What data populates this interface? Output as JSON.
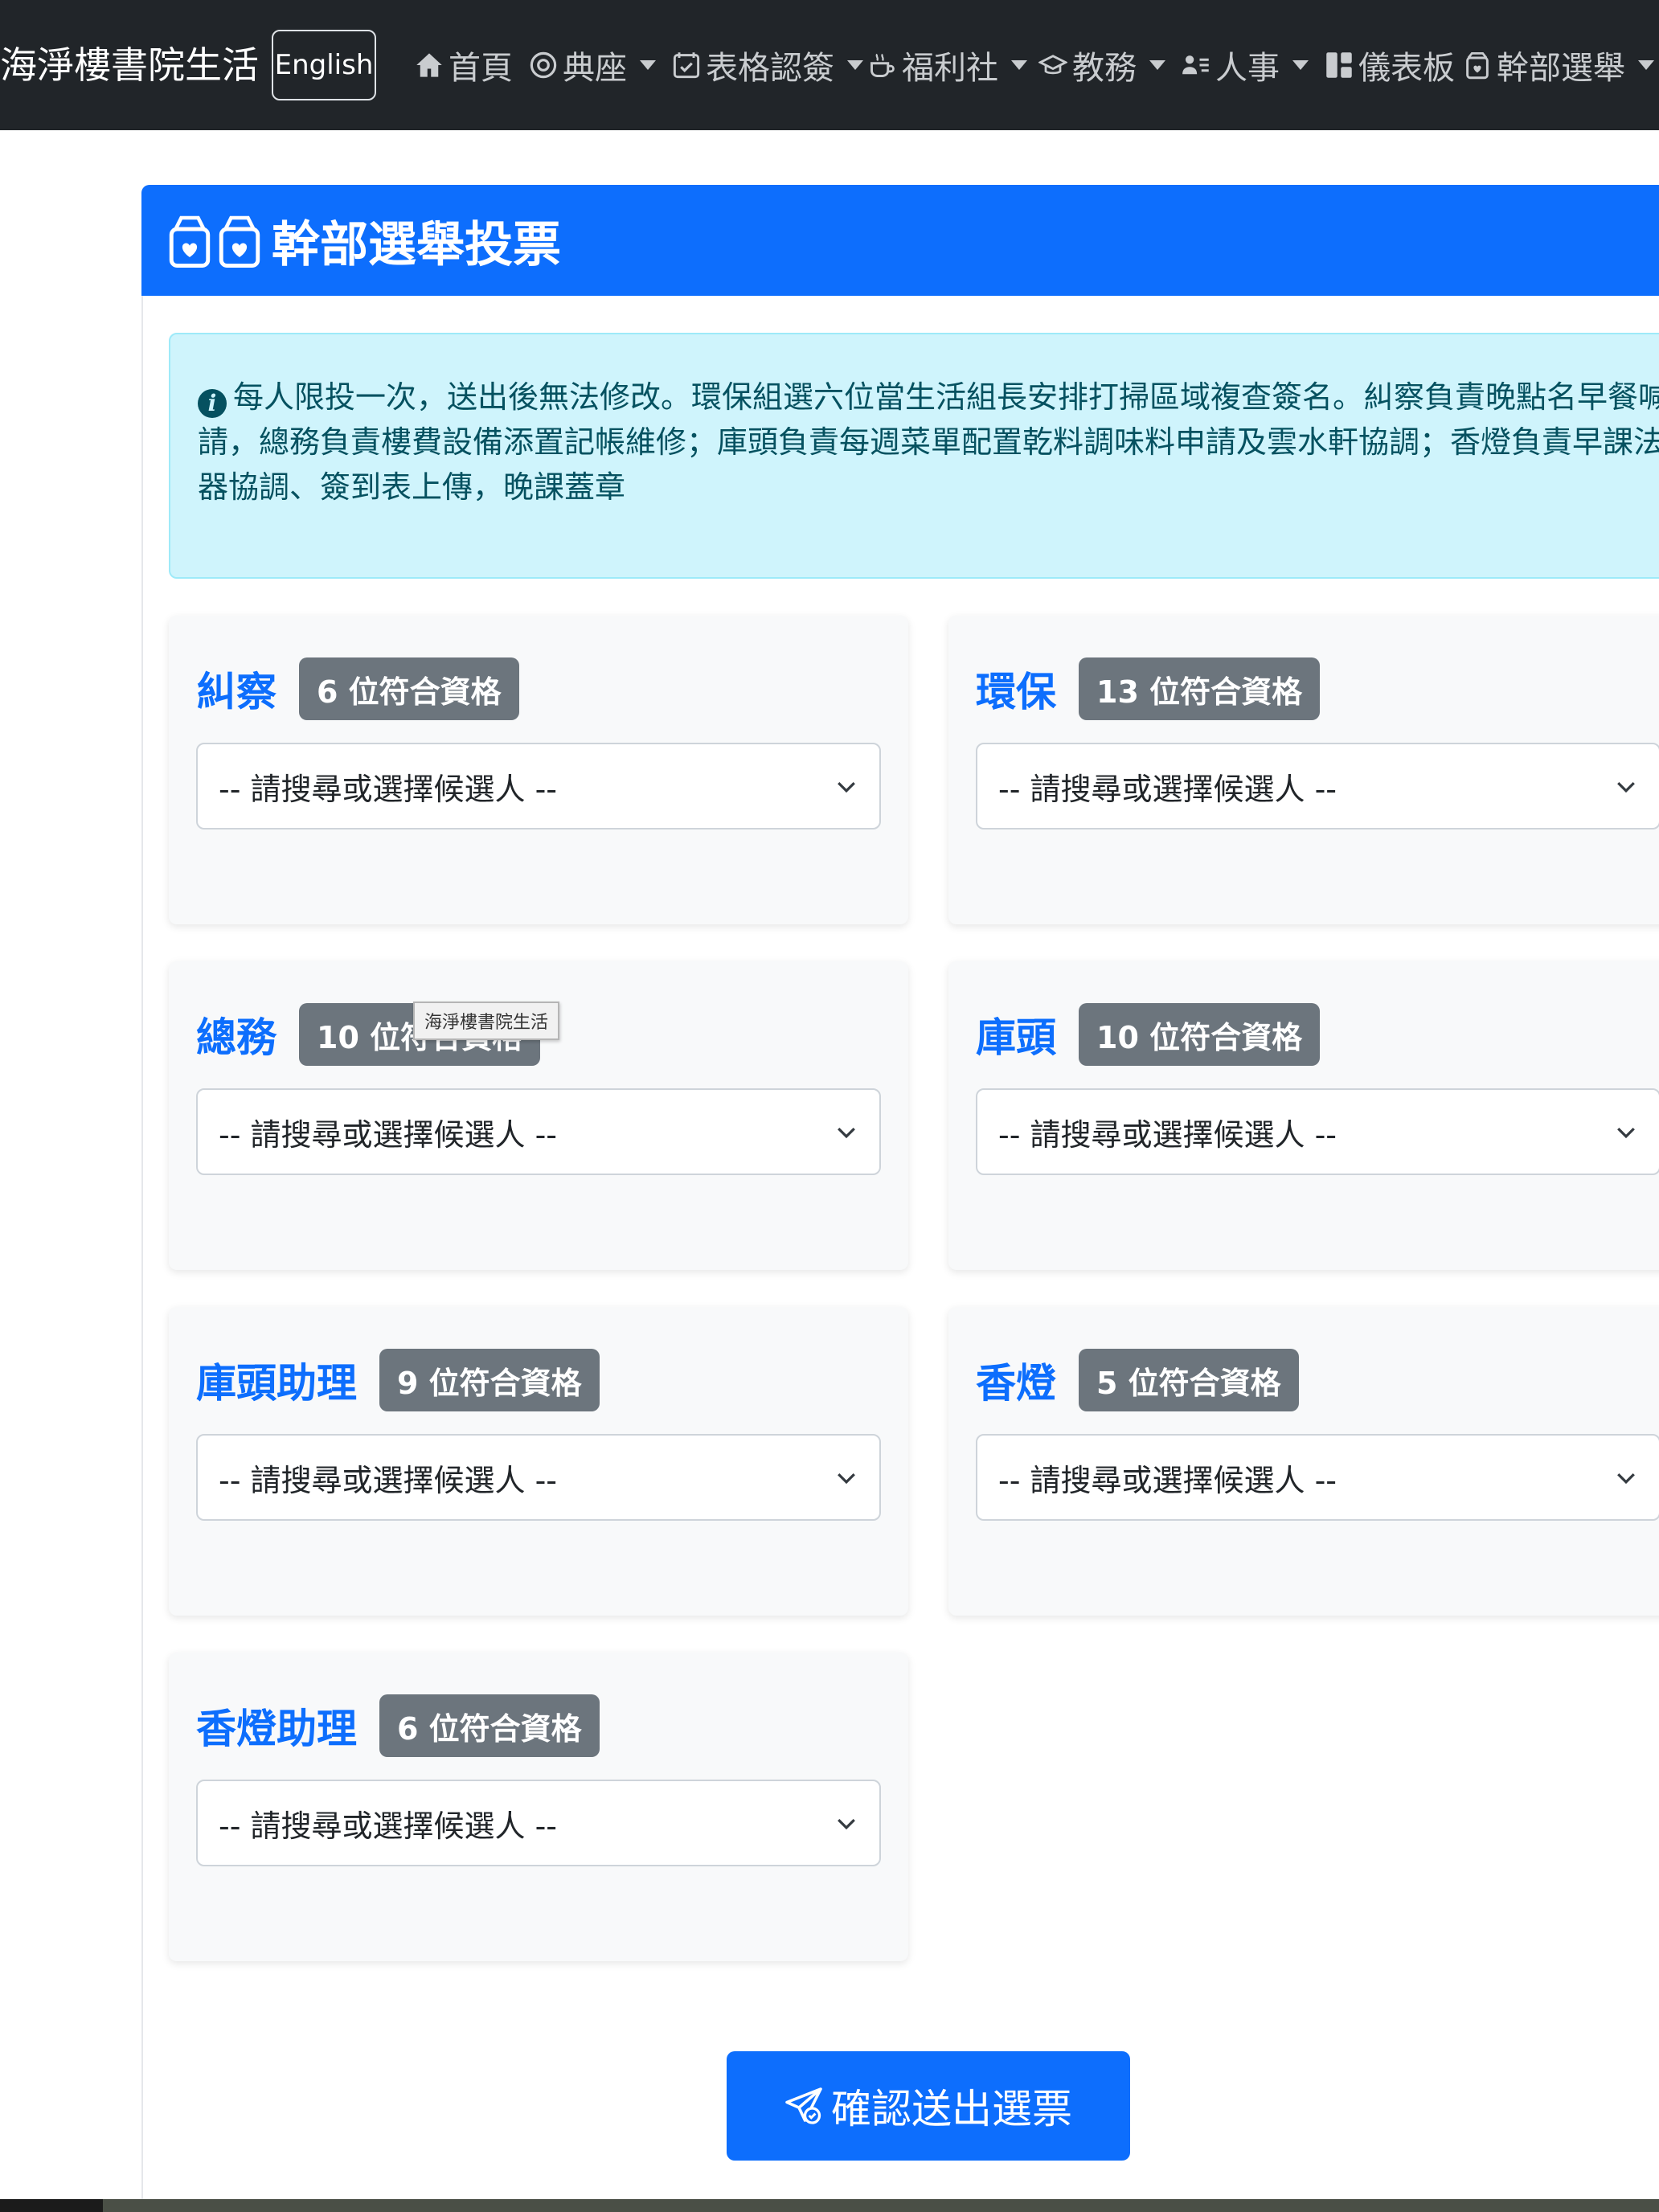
{
  "navbar": {
    "brand": "海淨樓書院生活",
    "lang_button": "English",
    "items": [
      {
        "label": "首頁",
        "icon": "house-icon",
        "dropdown": false
      },
      {
        "label": "典座",
        "icon": "bowl-icon",
        "dropdown": true
      },
      {
        "label": "表格認簽",
        "icon": "calendar-check-icon",
        "dropdown": true
      },
      {
        "label": "福利社",
        "icon": "cup-hot-icon",
        "dropdown": true
      },
      {
        "label": "教務",
        "icon": "mortarboard-icon",
        "dropdown": true
      },
      {
        "label": "人事",
        "icon": "person-lines-icon",
        "dropdown": true
      },
      {
        "label": "儀表板",
        "icon": "dashboard-icon",
        "dropdown": false
      },
      {
        "label": "幹部選舉",
        "icon": "ballot-box-icon",
        "dropdown": true
      }
    ]
  },
  "card": {
    "title": "幹部選舉投票",
    "icon": "ballot-box-icon"
  },
  "alert": {
    "icon": "info-circle-icon",
    "text": "每人限投一次，送出後無法修改。環保組選六位當生活組長安排打掃區域複查簽名。糾察負責晚點名早餐喊請，總務負責樓費設備添置記帳維修；庫頭負責每週菜單配置乾料調味料申請及雲水軒協調；香燈負責早課法器協調、簽到表上傳，晚課蓋章"
  },
  "positions": [
    {
      "name": "糾察",
      "badge": "6 位符合資格",
      "placeholder": "-- 請搜尋或選擇候選人 --"
    },
    {
      "name": "環保",
      "badge": "13 位符合資格",
      "placeholder": "-- 請搜尋或選擇候選人 --"
    },
    {
      "name": "總務",
      "badge": "10 位符合資格",
      "placeholder": "-- 請搜尋或選擇候選人 --"
    },
    {
      "name": "庫頭",
      "badge": "10 位符合資格",
      "placeholder": "-- 請搜尋或選擇候選人 --"
    },
    {
      "name": "庫頭助理",
      "badge": "9 位符合資格",
      "placeholder": "-- 請搜尋或選擇候選人 --"
    },
    {
      "name": "香燈",
      "badge": "5 位符合資格",
      "placeholder": "-- 請搜尋或選擇候選人 --"
    },
    {
      "name": "香燈助理",
      "badge": "6 位符合資格",
      "placeholder": "-- 請搜尋或選擇候選人 --"
    }
  ],
  "tooltip": "海淨樓書院生活",
  "submit": {
    "label": "確認送出選票",
    "icon": "send-check-icon"
  },
  "colors": {
    "navbar": "#212529",
    "primary": "#0d6efd",
    "alert_bg": "#cff4fc",
    "badge": "#6c757d"
  }
}
